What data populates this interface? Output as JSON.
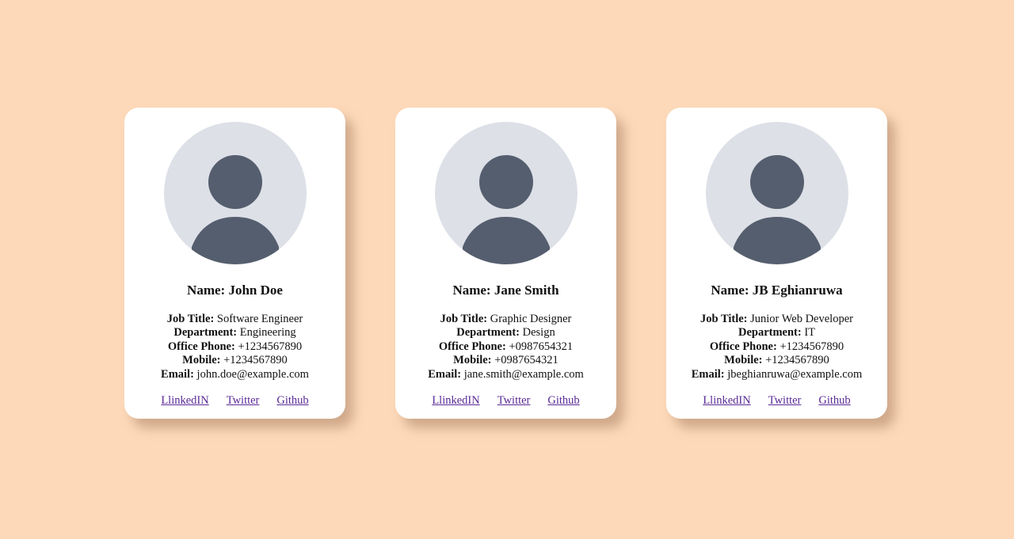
{
  "colors": {
    "background": "#fdd9b9",
    "card": "#ffffff",
    "avatar_bg": "#dde0e7",
    "avatar_figure": "#555e6e",
    "link": "#5a2a96"
  },
  "labels": {
    "name": "Name:",
    "job_title": "Job Title:",
    "department": "Department:",
    "office_phone": "Office Phone:",
    "mobile": "Mobile:",
    "email": "Email:"
  },
  "cards": [
    {
      "name": "John Doe",
      "job_title": "Software Engineer",
      "department": "Engineering",
      "office_phone": "+1234567890",
      "mobile": "+1234567890",
      "email": "john.doe@example.com",
      "avatar_icon": "user-avatar-icon",
      "links": [
        "LlinkedIN",
        "Twitter",
        "Github"
      ]
    },
    {
      "name": "Jane Smith",
      "job_title": "Graphic Designer",
      "department": "Design",
      "office_phone": "+0987654321",
      "mobile": "+0987654321",
      "email": "jane.smith@example.com",
      "avatar_icon": "user-avatar-icon",
      "links": [
        "LlinkedIN",
        "Twitter",
        "Github"
      ]
    },
    {
      "name": "JB Eghianruwa",
      "job_title": "Junior Web Developer",
      "department": "IT",
      "office_phone": "+1234567890",
      "mobile": "+1234567890",
      "email": "jbeghianruwa@example.com",
      "avatar_icon": "user-avatar-icon",
      "links": [
        "LlinkedIN",
        "Twitter",
        "Github"
      ]
    }
  ]
}
